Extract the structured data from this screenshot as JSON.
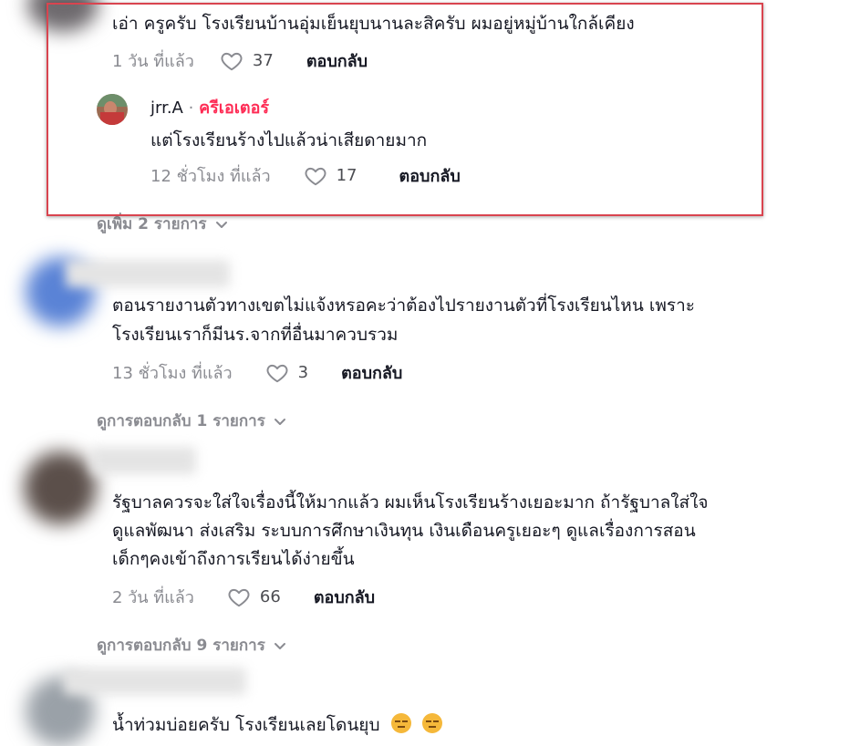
{
  "thread1": {
    "comment_text": "เอ่า ครูครับ โรงเรียนบ้านอุ่มเย็นยุบนานละสิครับ ผมอยู่หมู่บ้านใกล้เคียง",
    "time": "1 วัน ที่แล้ว",
    "likes": "37",
    "reply_label": "ตอบกลับ",
    "reply": {
      "username": "jrr.A",
      "separator": "·",
      "creator_label": "ครีเอเตอร์",
      "text": "แต่โรงเรียนร้างไปแล้วน่าเสียดายมาก",
      "time": "12 ชั่วโมง ที่แล้ว",
      "likes": "17",
      "reply_label": "ตอบกลับ"
    },
    "view_more": "ดูเพิ่ม 2 รายการ"
  },
  "thread2": {
    "comment_lines": [
      "ตอนรายงานตัวทางเขตไม่แจ้งหรอคะว่าต้องไปรายงานตัวที่โรงเรียนไหน เพราะ",
      "โรงเรียนเราก็มีนร.จากที่อื่นมาควบรวม"
    ],
    "time": "13 ชั่วโมง ที่แล้ว",
    "likes": "3",
    "reply_label": "ตอบกลับ",
    "view_replies": "ดูการตอบกลับ 1 รายการ"
  },
  "thread3": {
    "comment_lines": [
      "รัฐบาลควรจะใส่ใจเรื่องนี้ให้มากแล้ว ผมเห็นโรงเรียนร้างเยอะมาก ถ้ารัฐบาลใส่ใจ",
      "ดูแลพัฒนา ส่งเสริม ระบบการศึกษาเงินทุน เงินเดือนครูเยอะๆ ดูแลเรื่องการสอน",
      "เด็กๆคงเข้าถึงการเรียนได้ง่ายขึ้น"
    ],
    "time": "2 วัน ที่แล้ว",
    "likes": "66",
    "reply_label": "ตอบกลับ",
    "view_replies": "ดูการตอบกลับ 9 รายการ"
  },
  "thread4": {
    "comment_text": "น้ำท่วมบ่อยครับ โรงเรียนเลยโดนยุบ"
  },
  "colors": {
    "creator_accent": "#fe2c55",
    "highlight_border": "#d9444f",
    "meta_gray": "#8a8b91"
  },
  "icons": [
    "heart-outline-icon",
    "chevron-down-icon",
    "expressionless-face-emoji"
  ]
}
